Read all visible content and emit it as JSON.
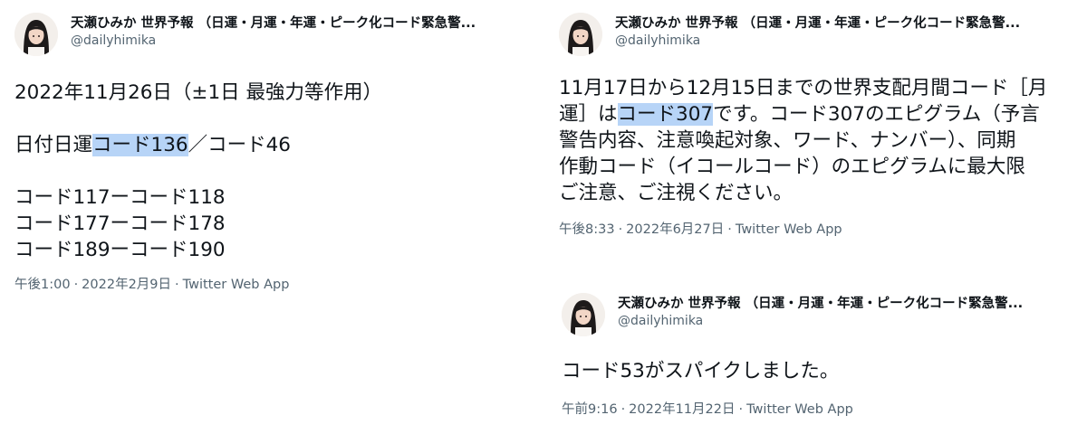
{
  "author": {
    "display_name": "天瀬ひみか 世界予報 （日運・月運・年運・ピーク化コード緊急警...",
    "handle": "@dailyhimika"
  },
  "tweets": [
    {
      "body": {
        "line1": "2022年11月26日（±1日 最強力等作用）",
        "line2_pre": "日付日運",
        "line2_hl": "コード136",
        "line2_post": "／コード46",
        "line3": "コード117ーコード118",
        "line4": "コード177ーコード178",
        "line5": "コード189ーコード190"
      },
      "meta": {
        "time": "午後1:00",
        "date": "2022年2月9日",
        "source": "Twitter Web App"
      }
    },
    {
      "body": {
        "line1": "11月17日から12月15日までの世界支配月間コード［月",
        "line2_pre": "運］は",
        "line2_hl": "コード307",
        "line2_post": "です。コード307のエピグラム（予言",
        "line3": "警告内容、注意喚起対象、ワード、ナンバー）、同期",
        "line4": "作動コード（イコールコード）のエピグラムに最大限",
        "line5": "ご注意、ご注視ください。"
      },
      "meta": {
        "time": "午後8:33",
        "date": "2022年6月27日",
        "source": "Twitter Web App"
      }
    },
    {
      "body": {
        "line1": "コード53がスパイクしました。"
      },
      "meta": {
        "time": "午前9:16",
        "date": "2022年11月22日",
        "source": "Twitter Web App"
      }
    }
  ],
  "separator": "·",
  "colors": {
    "highlight": "#b7d4f7",
    "secondary_text": "#536471",
    "primary_text": "#0f1419"
  }
}
